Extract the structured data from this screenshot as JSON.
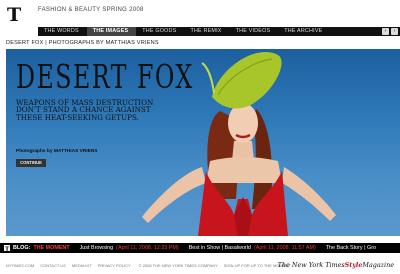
{
  "header": {
    "logo_icon": "nyt-t-logo-icon",
    "section_title": "FASHION & BEAUTY SPRING 2008"
  },
  "nav": {
    "items": [
      {
        "label": "THE WORDS"
      },
      {
        "label": "THE IMAGES"
      },
      {
        "label": "THE GOODS"
      },
      {
        "label": "THE REMIX"
      },
      {
        "label": "THE VIDEOS"
      },
      {
        "label": "THE ARCHIVE"
      }
    ],
    "active_index": 1,
    "prev_icon": "chevron-left-icon",
    "next_icon": "chevron-right-icon",
    "prev_glyph": "‹",
    "next_glyph": "›"
  },
  "caption": "DESERT FOX | PHOTOGRAPHS BY MATTHIAS VRIENS",
  "hero": {
    "title": "DESERT FOX",
    "subtitle": "WEAPONS OF MASS DESTRUCTION DON'T STAND A CHANCE AGAINST THESE HEAT-SEEKING GETUPS.",
    "credit": "Photographs by MATTHIAS VRIENS",
    "continue_label": "CONTINUE"
  },
  "ticker": {
    "blog_label": "BLOG:",
    "blog_name": "THE MOMENT",
    "items": [
      {
        "title": "Just Browsing",
        "date": "(April 11, 2008, 12:23 PM)"
      },
      {
        "title": "Best in Show | Basalworld",
        "date": "(April 11, 2008, 11:57 AM)"
      },
      {
        "title": "The Back Story | Gro",
        "date": ""
      }
    ]
  },
  "footer": {
    "links": [
      "NYTIMES.COM",
      "CONTACT US",
      "MEDIA KIT",
      "PRIVACY POLICY"
    ],
    "copyright": "© 2008 THE NEW YORK TIMES COMPANY",
    "signup": "SIGN UP FOR UP TO THE MOMENT",
    "brand_prefix": "The New York Times",
    "brand_style": "Style",
    "brand_suffix": "Magazine"
  },
  "colors": {
    "sky": "#2e78b8",
    "dress_red": "#c8141c",
    "hat_green": "#a8c62a",
    "ticker_accent": "#ff3b30"
  }
}
